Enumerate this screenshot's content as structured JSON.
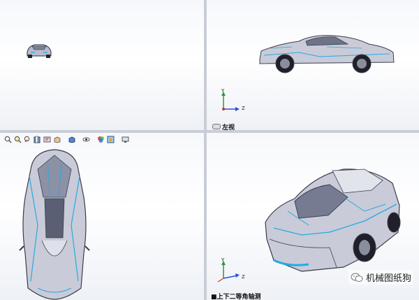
{
  "views": {
    "top_right_label": "左视",
    "bottom_right_label": "上下二等角轴测"
  },
  "triad": {
    "y_label": "Y",
    "z_label": "Z"
  },
  "toolbar": {
    "icons": [
      "zoom-to-fit-icon",
      "zoom-area-icon",
      "previous-view-icon",
      "section-view-icon",
      "dynamic-annotation-icon",
      "view-orientation-icon",
      "display-style-icon",
      "hide-show-icon",
      "edit-appearance-icon",
      "apply-scene-icon",
      "view-settings-icon"
    ]
  },
  "watermark": {
    "text": "机械图纸狗"
  },
  "colors": {
    "accent_blue": "#28a9e0",
    "car_body": "#c9cbd8",
    "car_outline": "#3a3d4a",
    "divider": "#c9ced6"
  }
}
